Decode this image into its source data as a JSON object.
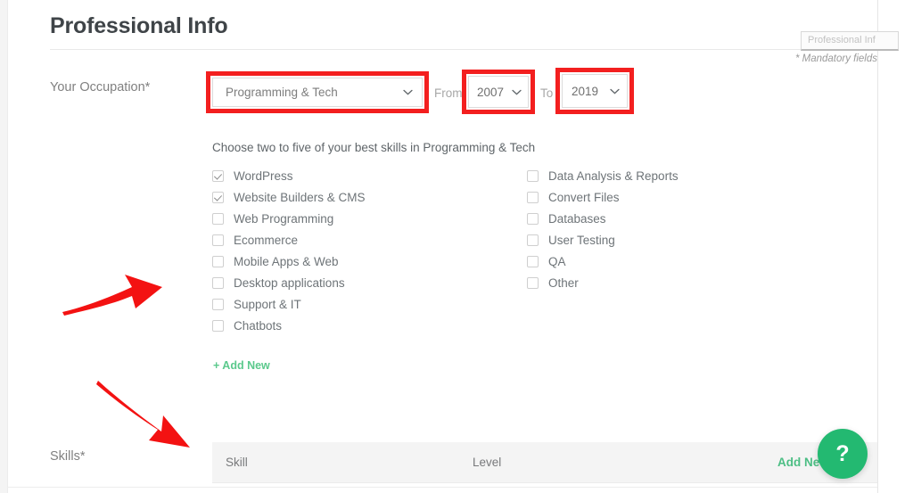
{
  "header": {
    "title": "Professional Info",
    "ghost_tab_label": "Professional Inf",
    "mandatory_note": "* Mandatory fields"
  },
  "occupation": {
    "label": "Your Occupation*",
    "selected": "Programming & Tech",
    "from_label": "From",
    "from_value": "2007",
    "to_label": "To",
    "to_value": "2019"
  },
  "skills_chooser": {
    "hint": "Choose two to five of your best skills in Programming & Tech",
    "add_new": "+ Add New",
    "left_column": [
      {
        "label": "WordPress",
        "checked": true
      },
      {
        "label": "Website Builders & CMS",
        "checked": true
      },
      {
        "label": "Web Programming",
        "checked": false
      },
      {
        "label": "Ecommerce",
        "checked": false
      },
      {
        "label": "Mobile Apps & Web",
        "checked": false
      },
      {
        "label": "Desktop applications",
        "checked": false
      },
      {
        "label": "Support & IT",
        "checked": false
      },
      {
        "label": "Chatbots",
        "checked": false
      }
    ],
    "right_column": [
      {
        "label": "Data Analysis & Reports",
        "checked": false
      },
      {
        "label": "Convert Files",
        "checked": false
      },
      {
        "label": "Databases",
        "checked": false
      },
      {
        "label": "User Testing",
        "checked": false
      },
      {
        "label": "QA",
        "checked": false
      },
      {
        "label": "Other",
        "checked": false
      }
    ]
  },
  "skills_table": {
    "label": "Skills*",
    "columns": [
      "Skill",
      "Level"
    ],
    "add_new": "Add New"
  },
  "help": {
    "glyph": "?"
  },
  "colors": {
    "highlight_red": "#f31f1f",
    "accent_green": "#23b971",
    "link_green": "#5bc98c",
    "text_gray": "#6e7478"
  }
}
